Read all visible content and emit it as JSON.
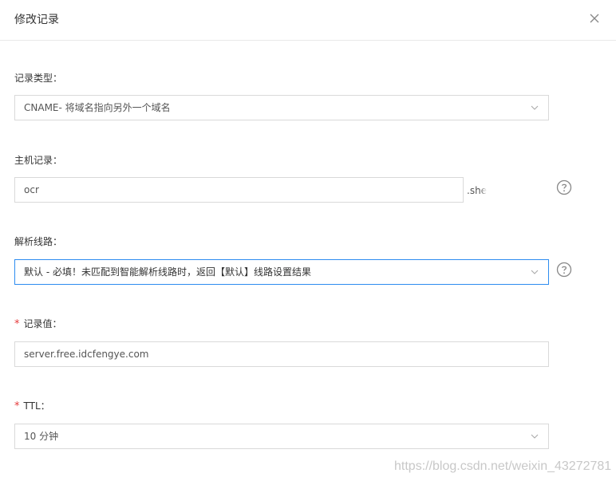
{
  "dialog": {
    "title": "修改记录"
  },
  "record_type": {
    "label": "记录类型：",
    "value": "CNAME- 将域名指向另外一个域名"
  },
  "host_record": {
    "label": "主机记录：",
    "value": "ocr",
    "suffix": ".she"
  },
  "resolve_line": {
    "label": "解析线路：",
    "value": "默认 - 必填！未匹配到智能解析线路时，返回【默认】线路设置结果"
  },
  "record_value": {
    "required_mark": "*",
    "label": "记录值：",
    "value": "server.free.idcfengye.com"
  },
  "ttl": {
    "required_mark": "*",
    "label": "TTL：",
    "value": "10 分钟"
  },
  "watermark": "https://blog.csdn.net/weixin_43272781",
  "colors": {
    "accent": "#2d8cf0",
    "required": "#e5393b",
    "border": "#d9d9d9"
  },
  "icons": [
    "close-icon",
    "chevron-down-icon",
    "help-circle-icon"
  ]
}
